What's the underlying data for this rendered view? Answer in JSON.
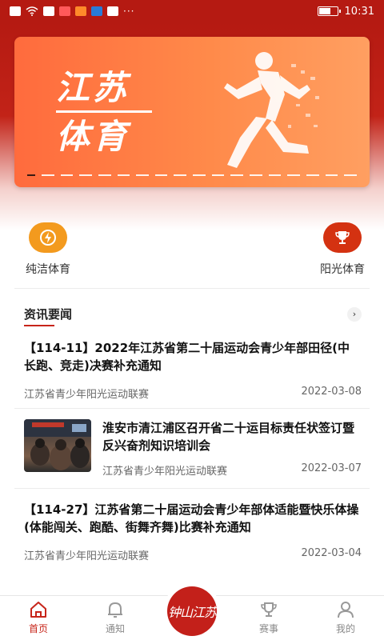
{
  "status_bar": {
    "time": "10:31",
    "more": "···"
  },
  "banner": {
    "line1": "江苏",
    "line2": "体育"
  },
  "quick_entries": [
    {
      "label": "纯洁体育",
      "icon": "lightning-badge-icon",
      "color": "#f39a1e"
    },
    {
      "label": "阳光体育",
      "icon": "trophy-icon",
      "color": "#d43211"
    }
  ],
  "news": {
    "section_title": "资讯要闻",
    "articles": [
      {
        "headline": "【114-11】2022年江苏省第二十届运动会青少年部田径(中长跑、竞走)决赛补充通知",
        "source": "江苏省青少年阳光运动联赛",
        "date": "2022-03-08"
      },
      {
        "headline": "淮安市清江浦区召开省二十运目标责任状签订暨反兴奋剂知识培训会",
        "source": "江苏省青少年阳光运动联赛",
        "date": "2022-03-07"
      },
      {
        "headline": "【114-27】江苏省第二十届运动会青少年部体适能暨快乐体操(体能闯关、跑酷、街舞齐舞)比赛补充通知",
        "source": "江苏省青少年阳光运动联赛",
        "date": "2022-03-04"
      }
    ]
  },
  "bottom_nav": {
    "items": [
      {
        "label": "首页",
        "icon": "home-icon",
        "active": true
      },
      {
        "label": "通知",
        "icon": "bell-icon",
        "active": false
      },
      {
        "label": "赛事",
        "icon": "trophy-icon",
        "active": false
      },
      {
        "label": "我的",
        "icon": "user-icon",
        "active": false
      }
    ],
    "center_logo_text": "钟山江苏"
  },
  "colors": {
    "primary_red": "#c7251a",
    "header_red": "#b51a12",
    "banner_orange": "#ff7a45"
  }
}
